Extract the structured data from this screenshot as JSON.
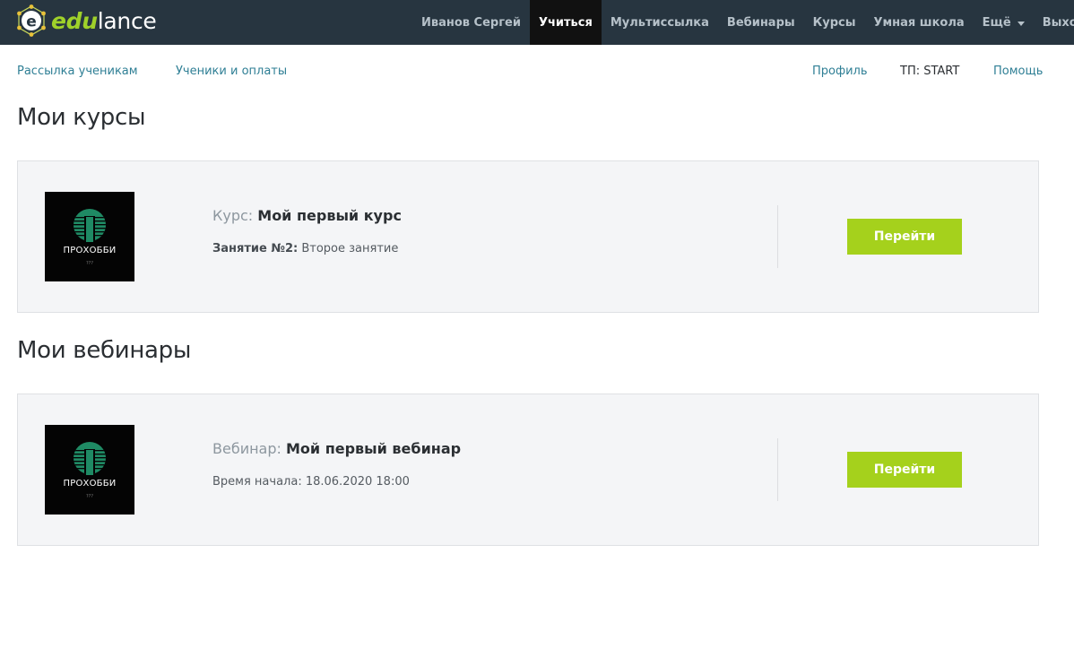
{
  "brand": {
    "edu": "edu",
    "lance": "lance",
    "accent": "#9fd12a"
  },
  "nav": {
    "items": [
      "Иванов Сергей",
      "Учиться",
      "Мультиссылка",
      "Вебинары",
      "Курсы",
      "Умная школа",
      "Ещё",
      "Выход"
    ],
    "active": "Учиться"
  },
  "subnav": {
    "mailing": "Рассылка ученикам",
    "students": "Ученики и оплаты",
    "profile": "Профиль",
    "tp": "ТП: START",
    "help": "Помощь"
  },
  "courses": {
    "title": "Мои курсы",
    "card": {
      "thumb_name": "ПРОХОББИ",
      "thumb_sub": "???",
      "label": "Курс:",
      "name": "Мой первый курс",
      "meta_label": "Занятие №2:",
      "meta_value": "Второе занятие",
      "button": "Перейти"
    }
  },
  "webinars": {
    "title": "Мои вебинары",
    "card": {
      "thumb_name": "ПРОХОББИ",
      "thumb_sub": "???",
      "label": "Вебинар:",
      "name": "Мой первый вебинар",
      "meta_label": "Время начала:",
      "meta_value": "18.06.2020 18:00",
      "button": "Перейти"
    }
  },
  "colors": {
    "topbar": "#273540",
    "link": "#2f7f95",
    "button": "#a5d11c",
    "card_bg": "#f4f5f7"
  },
  "icons": [
    "edulance-logo-icon",
    "caret-down-icon",
    "prohobbi-logo-icon"
  ]
}
